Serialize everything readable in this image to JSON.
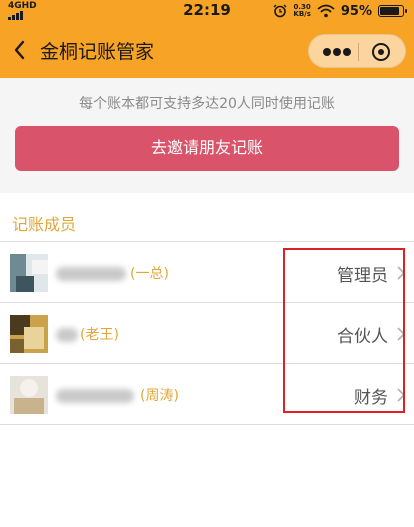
{
  "status_bar": {
    "network": "4GHD",
    "time": "22:19",
    "speed_value": "0.30",
    "speed_unit": "KB/s",
    "battery_percent": "95%",
    "battery_level": 0.95,
    "icons": [
      "signal-icon",
      "alarm-icon",
      "wifi-icon",
      "battery-icon"
    ]
  },
  "nav": {
    "title": "金桐记账管家",
    "back_icon": "chevron-left-icon",
    "more_icon": "more-dots-icon",
    "close_icon": "target-close-icon"
  },
  "hint": "每个账本都可支持多达20人同时使用记账",
  "invite_button": "去邀请朋友记账",
  "section_title": "记账成员",
  "members": [
    {
      "nickname": "(一总)",
      "role": "管理员"
    },
    {
      "nickname": "(老王)",
      "role": "合伙人"
    },
    {
      "nickname": "(周涛)",
      "role": "财务"
    }
  ],
  "colors": {
    "header": "#f7a326",
    "invite_button": "#d9546a",
    "accent_text": "#e0a83a",
    "highlight": "#e02020"
  }
}
